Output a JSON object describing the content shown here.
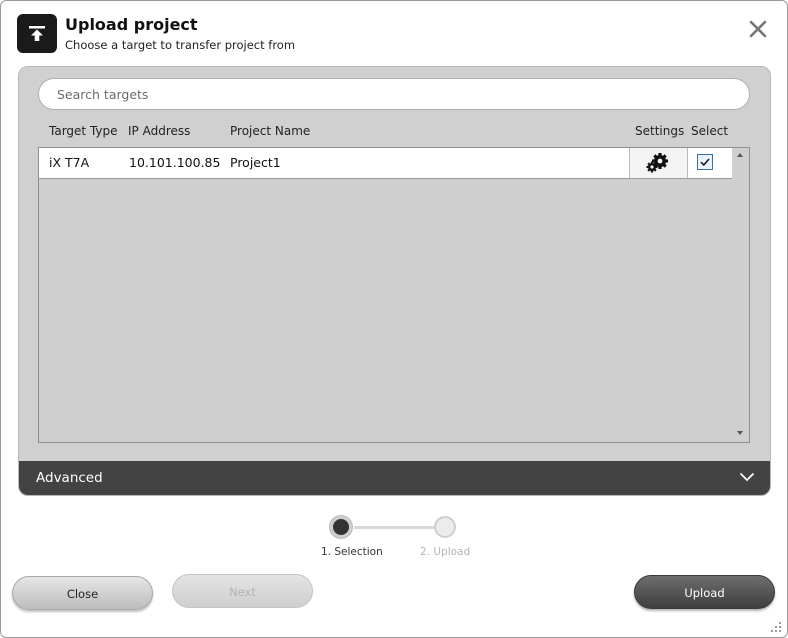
{
  "header": {
    "title": "Upload project",
    "subtitle": "Choose a target to transfer project from",
    "icon": "upload-icon"
  },
  "search": {
    "placeholder": "Search targets",
    "value": ""
  },
  "table": {
    "columns": [
      "Target Type",
      "IP Address",
      "Project Name",
      "Settings",
      "Select"
    ],
    "rows": [
      {
        "target_type": "iX T7A",
        "ip_address": "10.101.100.85",
        "project_name": "Project1",
        "settings_icon": "gear-icon",
        "selected": true
      }
    ]
  },
  "advanced": {
    "label": "Advanced",
    "expanded": false
  },
  "stepper": {
    "steps": [
      "1. Selection",
      "2. Upload"
    ],
    "current_step": 1
  },
  "buttons": {
    "close": "Close",
    "next": "Next",
    "upload": "Upload"
  },
  "colors": {
    "panel_bg": "#d0d0d0",
    "advanced_bar": "#434343",
    "checkbox_accent": "#3a6ea5",
    "upload_button": "#4a4a4a"
  }
}
